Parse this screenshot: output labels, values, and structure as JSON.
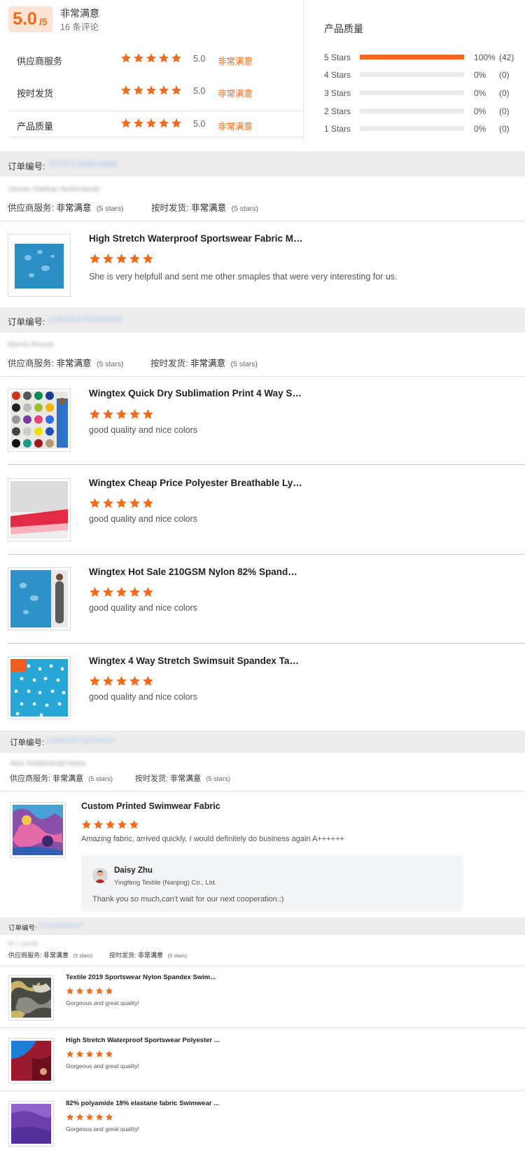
{
  "summary": {
    "score": "5.0",
    "score_of": "/5",
    "title": "非常满意",
    "review_count": "16 条评论",
    "ratings": [
      {
        "label": "供应商服务",
        "stars": 5,
        "value": "5.0",
        "text": "非常满意"
      },
      {
        "label": "按时发货",
        "stars": 5,
        "value": "5.0",
        "text": "非常满意"
      },
      {
        "label": "产品质量",
        "stars": 5,
        "value": "5.0",
        "text": "非常满意"
      }
    ]
  },
  "quality": {
    "title": "产品质量",
    "bars": [
      {
        "label": "5 Stars",
        "percent": "100%",
        "count": "(42)",
        "fraction": 1.0
      },
      {
        "label": "4 Stars",
        "percent": "0%",
        "count": "(0)",
        "fraction": 0
      },
      {
        "label": "3 Stars",
        "percent": "0%",
        "count": "(0)",
        "fraction": 0
      },
      {
        "label": "2 Stars",
        "percent": "0%",
        "count": "(0)",
        "fraction": 0
      },
      {
        "label": "1 Stars",
        "percent": "0%",
        "count": "(0)",
        "fraction": 0
      }
    ]
  },
  "orders": [
    {
      "label": "订单编号:",
      "order_id": "107471209010894",
      "buyer": "Usman Saeban Netherlands",
      "supplier_label": "供应商服务:",
      "supplier_value": "非常满意",
      "supplier_stars": "(5 stars)",
      "ontime_label": "按时发货:",
      "ontime_value": "非常满意",
      "ontime_stars": "(5 stars)",
      "items": [
        {
          "title": "High Stretch Waterproof Sportswear Fabric Ma...",
          "stars": 5,
          "comment": "She is very helpfull and sent me other smaples that were very interesting for us."
        }
      ]
    },
    {
      "label": "订单编号:",
      "order_id": "1230054789316584",
      "buyer": "Marvin Rossie",
      "supplier_label": "供应商服务:",
      "supplier_value": "非常满意",
      "supplier_stars": "(5 stars)",
      "ontime_label": "按时发货:",
      "ontime_value": "非常满意",
      "ontime_stars": "(5 stars)",
      "items": [
        {
          "title": "Wingtex Quick Dry Sublimation Print 4 Way Str...",
          "stars": 5,
          "comment": "good quality and nice colors"
        },
        {
          "title": "Wingtex Cheap Price Polyester Breathable Lycr...",
          "stars": 5,
          "comment": "good quality and nice colors"
        },
        {
          "title": "Wingtex Hot Sale 210GSM Nylon 82% Spandex...",
          "stars": 5,
          "comment": "good quality and nice colors"
        },
        {
          "title": "Wingtex 4 Way Stretch Swimsuit Spandex Tact...",
          "stars": 5,
          "comment": "good quality and nice colors"
        }
      ]
    },
    {
      "label": "订单编号:",
      "order_id": "1058420718709623",
      "buyer": "Alice Rabbertsrad Nawa",
      "supplier_label": "供应商服务:",
      "supplier_value": "非常满意",
      "supplier_stars": "(5 stars)",
      "ontime_label": "按时发货:",
      "ontime_value": "非常满意",
      "ontime_stars": "(5 stars)",
      "items": [
        {
          "title": "Custom Printed Swimwear Fabric",
          "stars": 5,
          "comment": "Amazing fabric, arrived quickly, I would definitely do business again A++++++",
          "reply": {
            "name": "Daisy Zhu",
            "company": "Yingfeng Textile (Nanjing) Co., Ltd.",
            "text": "Thank you so much,can't wait for our next cooperation.:)"
          }
        }
      ]
    },
    {
      "label": "订单编号:",
      "order_id": "1023108505047",
      "buyer": "M L Lincoln",
      "supplier_label": "供应商服务:",
      "supplier_value": "非常满意",
      "supplier_stars": "(5 stars)",
      "ontime_label": "按时发货:",
      "ontime_value": "非常满意",
      "ontime_stars": "(5 stars)",
      "items": [
        {
          "title": "Textile 2019 Sportswear Nylon Spandex Swim...",
          "stars": 5,
          "comment": "Gorgeous and great quality!"
        },
        {
          "title": "High Stretch Waterproof Sportswear Polyester ...",
          "stars": 5,
          "comment": "Gorgeous and great quality!"
        },
        {
          "title": "82% polyamide 18% elastane fabric Swimwear ...",
          "stars": 5,
          "comment": "Gorgeous and great quality!"
        }
      ]
    }
  ],
  "colors": {
    "accent": "#f26b1d",
    "star": "#f26b1d",
    "section_bg": "#ededed",
    "muted": "#999999"
  },
  "icons": {
    "star": "star-icon",
    "avatar": "avatar-icon"
  }
}
